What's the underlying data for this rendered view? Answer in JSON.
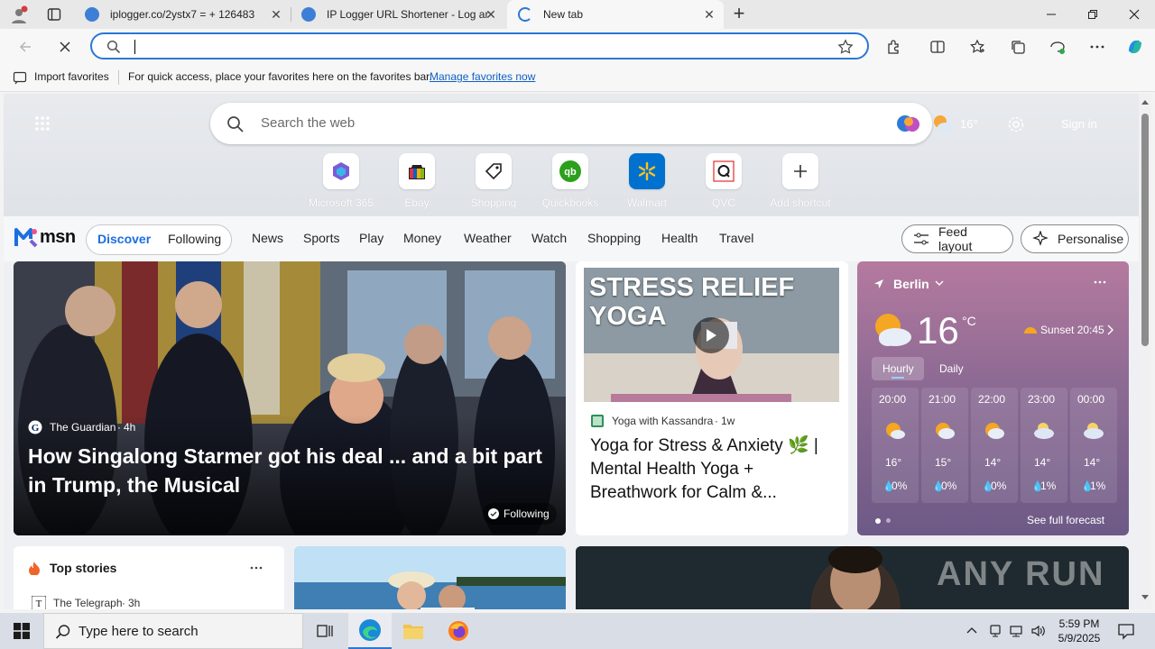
{
  "tabs": [
    {
      "title": "iplogger.co/2ystx7 = + 126483",
      "close": "✕"
    },
    {
      "title": "IP Logger URL Shortener - Log an",
      "close": "✕"
    },
    {
      "title": "New tab",
      "close": "✕"
    }
  ],
  "new_tab": "+",
  "address_bar": {
    "value": "",
    "placeholder": ""
  },
  "favorites_bar": {
    "import": "Import favorites",
    "hint": "For quick access, place your favorites here on the favorites bar.",
    "manage_link": "Manage favorites now"
  },
  "newtab": {
    "search_placeholder": "Search the web",
    "temp_faded": "16°",
    "signin_faded": "Sign in",
    "shortcuts": [
      {
        "label": "Microsoft 365",
        "icon": "microsoft365-icon"
      },
      {
        "label": "Ebay",
        "icon": "ebay-icon"
      },
      {
        "label": "Shopping",
        "icon": "shopping-tag-icon"
      },
      {
        "label": "Quickbooks",
        "icon": "quickbooks-icon"
      },
      {
        "label": "Walmart",
        "icon": "walmart-icon"
      },
      {
        "label": "QVC",
        "icon": "qvc-icon"
      },
      {
        "label": "Add shortcut",
        "icon": "plus-icon"
      }
    ]
  },
  "msn_nav": {
    "logo": "msn",
    "discover": "Discover",
    "following": "Following",
    "links": [
      "News",
      "Sports",
      "Play",
      "Money",
      "Weather",
      "Watch",
      "Shopping",
      "Health",
      "Travel"
    ],
    "feed_layout": "Feed layout",
    "personalise": "Personalise"
  },
  "big_story": {
    "source": "The Guardian",
    "age": "4h",
    "headline": "How Singalong Starmer got his deal ... and a bit part in Trump, the Musical",
    "following_badge": "Following"
  },
  "yoga_story": {
    "thumb_text": "STRESS RELIEF YOGA",
    "source": "Yoga with Kassandra",
    "age": "1w",
    "headline": "Yoga for Stress & Anxiety 🌿 | Mental Health Yoga + Breathwork for Calm &..."
  },
  "weather": {
    "city": "Berlin",
    "temp": "16",
    "unit": "°C",
    "sunset": "Sunset 20:45",
    "tab_hourly": "Hourly",
    "tab_daily": "Daily",
    "hours": [
      {
        "time": "20:00",
        "temp": "16°",
        "precip": "0%"
      },
      {
        "time": "21:00",
        "temp": "15°",
        "precip": "0%"
      },
      {
        "time": "22:00",
        "temp": "14°",
        "precip": "0%"
      },
      {
        "time": "23:00",
        "temp": "14°",
        "precip": "1%"
      },
      {
        "time": "00:00",
        "temp": "14°",
        "precip": "1%"
      }
    ],
    "see_full": "See full forecast"
  },
  "top_stories": {
    "title": "Top stories",
    "source": "The Telegraph",
    "age": "3h"
  },
  "watermark": "ANY RUN",
  "taskbar": {
    "search_placeholder": "Type here to search",
    "time": "5:59 PM",
    "date": "5/9/2025"
  },
  "colors": {
    "accent": "#2b78d6",
    "weather_top": "#b57a9f",
    "weather_bottom": "#6d5a86"
  }
}
